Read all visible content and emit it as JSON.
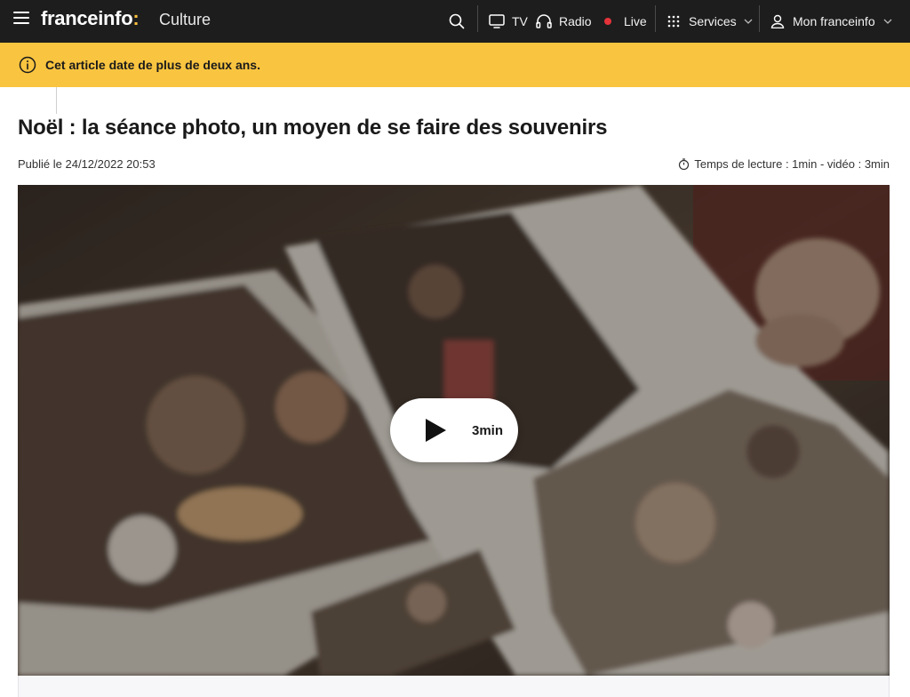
{
  "header": {
    "brand": "franceinfo",
    "brand_colon": ":",
    "section": "Culture",
    "nav": {
      "tv": "TV",
      "radio": "Radio",
      "live": "Live",
      "services": "Services",
      "account": "Mon franceinfo"
    },
    "icons": [
      "menu-icon",
      "search-icon",
      "tv-icon",
      "headphones-icon",
      "live-dot",
      "grid-icon",
      "chevron-down-icon",
      "user-icon"
    ]
  },
  "notice": {
    "text": "Cet article date de plus de deux ans.",
    "icon": "info-icon"
  },
  "article": {
    "title": "Noël : la séance photo, un moyen de se faire des souvenirs",
    "published": "Publié le 24/12/2022 20:53",
    "reading_time": "Temps de lecture : 1min - vidéo : 3min"
  },
  "video": {
    "duration": "3min"
  },
  "colors": {
    "topbar": "#1d1d1d",
    "accent_yellow": "#f9c440",
    "live_red": "#e5333a"
  }
}
